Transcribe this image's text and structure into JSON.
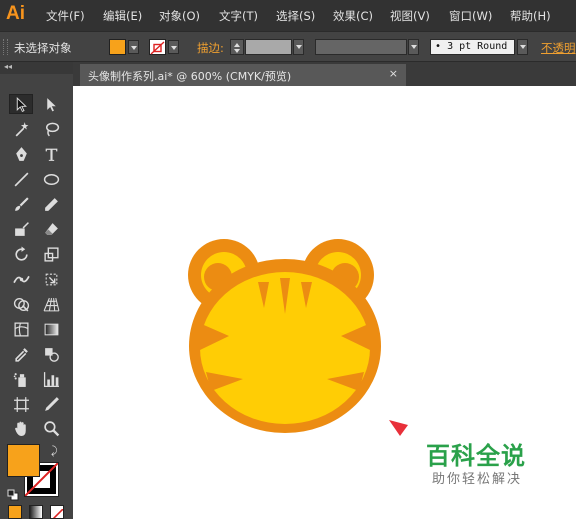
{
  "app": {
    "logo": "Ai"
  },
  "menu": [
    "文件(F)",
    "编辑(E)",
    "对象(O)",
    "文字(T)",
    "选择(S)",
    "效果(C)",
    "视图(V)",
    "窗口(W)",
    "帮助(H)"
  ],
  "control_bar": {
    "selection_status": "未选择对象",
    "fill_color": "#f7a21b",
    "stroke_label": "描边:",
    "brush": "3 pt Round",
    "opacity_label": "不透明"
  },
  "document_tab": {
    "title": "头像制作系列.ai* @ 600% (CMYK/预览)",
    "close": "×"
  },
  "tools": {
    "panel_collapse": "◂◂",
    "fill_color": "#f7a21b",
    "stroke_color": "#000000"
  },
  "artwork": {
    "subject": "tiger-face",
    "colors": {
      "outline": "#ec8c12",
      "face": "#ffcd05",
      "stripes": "#ec8c12"
    }
  },
  "watermark": {
    "title": "百科全说",
    "subtitle": "助你轻松解决"
  }
}
